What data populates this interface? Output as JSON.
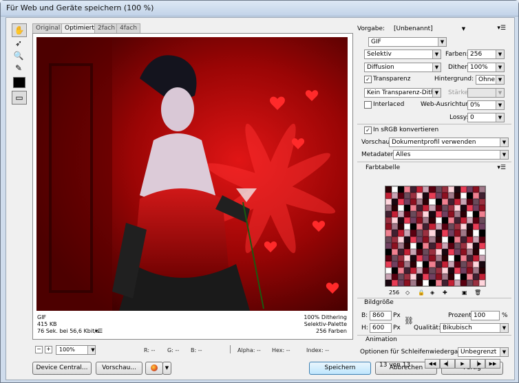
{
  "window": {
    "title": "Für Web und Geräte speichern (100 %)"
  },
  "tabs": [
    "Original",
    "Optimiert",
    "2fach",
    "4fach"
  ],
  "preview_info": {
    "format": "GIF",
    "size": "415 KB",
    "time": "76 Sek. bei 56,6 Kbit/s",
    "dithering": "100% Dithering",
    "palette": "Selektiv-Palette",
    "colors": "256 Farben"
  },
  "status": {
    "zoom": "100%",
    "r": "R: --",
    "g": "G: --",
    "b": "B: --",
    "alpha": "Alpha: --",
    "hex": "Hex: --",
    "index": "Index: --"
  },
  "buttons": {
    "device_central": "Device Central...",
    "preview": "Vorschau...",
    "save": "Speichern",
    "cancel": "Abbrechen",
    "done": "Fertig"
  },
  "settings": {
    "preset_label": "Vorgabe:",
    "preset": "[Unbenannt]",
    "format": "GIF",
    "reduction": "Selektiv",
    "colors_label": "Farben:",
    "colors": "256",
    "dither_algo": "Diffusion",
    "dither_label": "Dither:",
    "dither": "100%",
    "transparency_label": "Transparenz",
    "transparency": true,
    "matte_label": "Hintergrund:",
    "matte": "Ohne",
    "transparency_dither": "Kein Transparenz-Dither",
    "amount_label": "Stärke:",
    "interlaced_label": "Interlaced",
    "interlaced": false,
    "websnap_label": "Web-Ausrichtung:",
    "websnap": "0%",
    "lossy_label": "Lossy:",
    "lossy": "0",
    "srgb_label": "In sRGB konvertieren",
    "srgb": true,
    "preview_label": "Vorschau:",
    "preview": "Dokumentprofil verwenden",
    "metadata_label": "Metadaten:",
    "metadata": "Alles"
  },
  "color_table": {
    "title": "Farbtabelle",
    "count": "256",
    "colors": [
      "#2b0005",
      "#5a0010",
      "#8d1020",
      "#c42035",
      "#e83c55",
      "#f08090",
      "#ffd5dc",
      "#ffffff",
      "#6a4a5a",
      "#a07888",
      "#c9a4b4",
      "#704060",
      "#402030",
      "#1a0810",
      "#000000",
      "#9a3040"
    ]
  },
  "image_size": {
    "title": "Bildgröße",
    "w_label": "B:",
    "w": "860",
    "h_label": "H:",
    "h": "600",
    "unit": "Px",
    "percent_label": "Prozent:",
    "percent": "100",
    "percent_unit": "%",
    "quality_label": "Qualität:",
    "quality": "Bikubisch"
  },
  "animation": {
    "title": "Animation",
    "loop_label": "Optionen für Schleifenwiedergabe:",
    "loop": "Unbegrenzt",
    "frame": "13 von 13"
  }
}
